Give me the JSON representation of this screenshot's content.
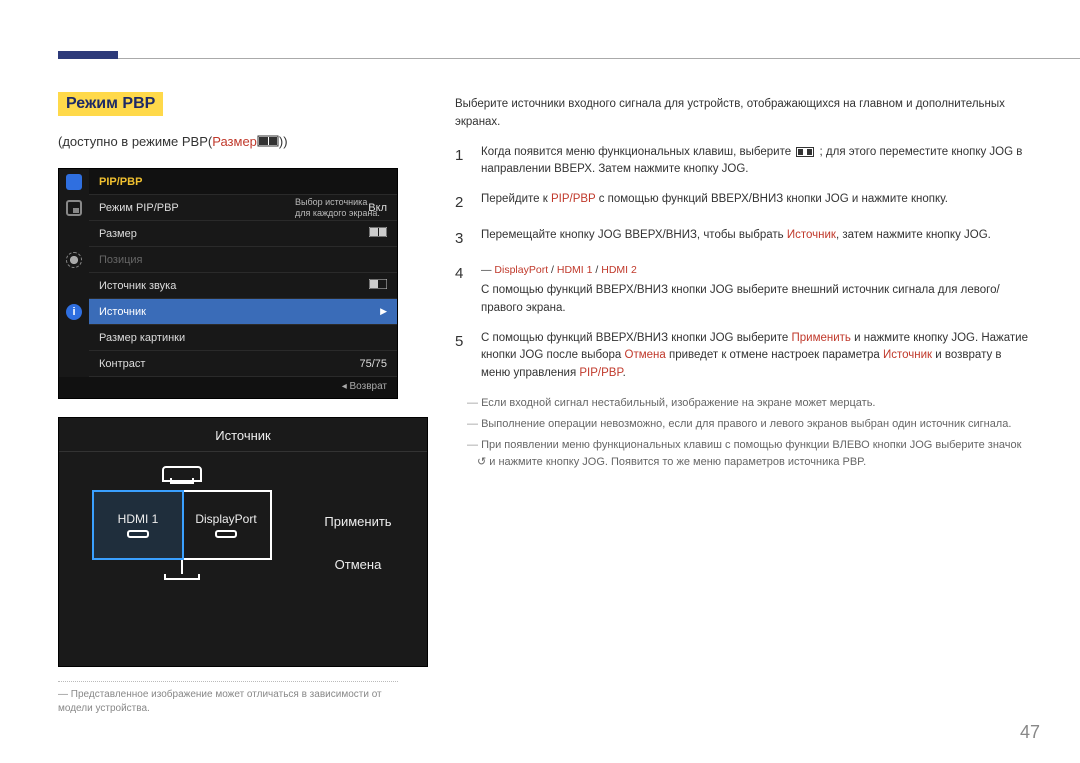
{
  "page_number": "47",
  "heading": "Режим PBP",
  "subheading_prefix": "(доступно в режиме PBP(",
  "subheading_red": "Размер",
  "subheading_suffix": "))",
  "osd1": {
    "tab": "PIP/PBP",
    "desc": "Выбор источника для каждого экрана.",
    "rows": [
      {
        "label": "Режим PIP/PBP",
        "value": "Вкл"
      },
      {
        "label": "Размер",
        "value_icon": true
      },
      {
        "label": "Позиция",
        "dim": true
      },
      {
        "label": "Источник звука",
        "value_icon": true
      },
      {
        "label": "Источник",
        "hl": true,
        "value": "▶"
      },
      {
        "label": "Размер картинки"
      },
      {
        "label": "Контраст",
        "value": "75/75"
      }
    ],
    "footer_back": "◂ Возврат"
  },
  "osd2": {
    "title": "Источник",
    "pane1": "HDMI 1",
    "pane2": "DisplayPort",
    "apply": "Применить",
    "cancel": "Отмена"
  },
  "footnote": "Представленное изображение может отличаться в зависимости от модели устройства.",
  "right": {
    "intro": "Выберите источники входного сигнала для устройств, отображающихся на главном и дополнительных экранах.",
    "steps": [
      {
        "n": "1",
        "parts": [
          {
            "t": "Когда появится меню функциональных клавиш, выберите "
          },
          {
            "icon": "menu"
          },
          {
            "t": " ; для этого переместите кнопку JOG в направлении ВВЕРХ. Затем нажмите кнопку JOG."
          }
        ]
      },
      {
        "n": "2",
        "parts": [
          {
            "t": "Перейдите к "
          },
          {
            "t": "PIP/PBP",
            "red": true
          },
          {
            "t": " с помощью функций ВВЕРХ/ВНИЗ кнопки JOG и нажмите кнопку."
          }
        ]
      },
      {
        "n": "3",
        "parts": [
          {
            "t": "Перемещайте кнопку JOG ВВЕРХ/ВНИЗ, чтобы выбрать "
          },
          {
            "t": "Источник",
            "red": true
          },
          {
            "t": ", затем нажмите кнопку JOG."
          }
        ]
      },
      {
        "n": "4",
        "pre": [
          {
            "t": "― ",
            "red": false
          },
          {
            "t": "DisplayPort",
            "red": true
          },
          {
            "t": " / "
          },
          {
            "t": "HDMI 1",
            "red": true
          },
          {
            "t": " / "
          },
          {
            "t": "HDMI 2",
            "red": true
          }
        ],
        "parts": [
          {
            "t": "С помощью функций ВВЕРХ/ВНИЗ кнопки JOG выберите внешний источник сигнала для левого/правого экрана."
          }
        ]
      },
      {
        "n": "5",
        "parts": [
          {
            "t": "С помощью функций ВВЕРХ/ВНИЗ кнопки JOG выберите "
          },
          {
            "t": "Применить",
            "red": true
          },
          {
            "t": " и нажмите кнопку JOG. Нажатие кнопки JOG после выбора "
          },
          {
            "t": "Отмена",
            "red": true
          },
          {
            "t": " приведет к отмене настроек параметра "
          },
          {
            "t": "Источник",
            "red": true
          },
          {
            "t": " и возврату в меню управления "
          },
          {
            "t": "PIP/PBP",
            "red": true
          },
          {
            "t": "."
          }
        ]
      }
    ],
    "notes": [
      "Если входной сигнал нестабильный, изображение на экране может мерцать.",
      "Выполнение операции невозможно, если для правого и левого экранов выбран один источник сигнала.",
      "При появлении меню функциональных клавиш с помощью функции ВЛЕВО кнопки JOG выберите значок ↺ и нажмите кнопку JOG. Появится то же меню параметров источника PBP."
    ]
  }
}
